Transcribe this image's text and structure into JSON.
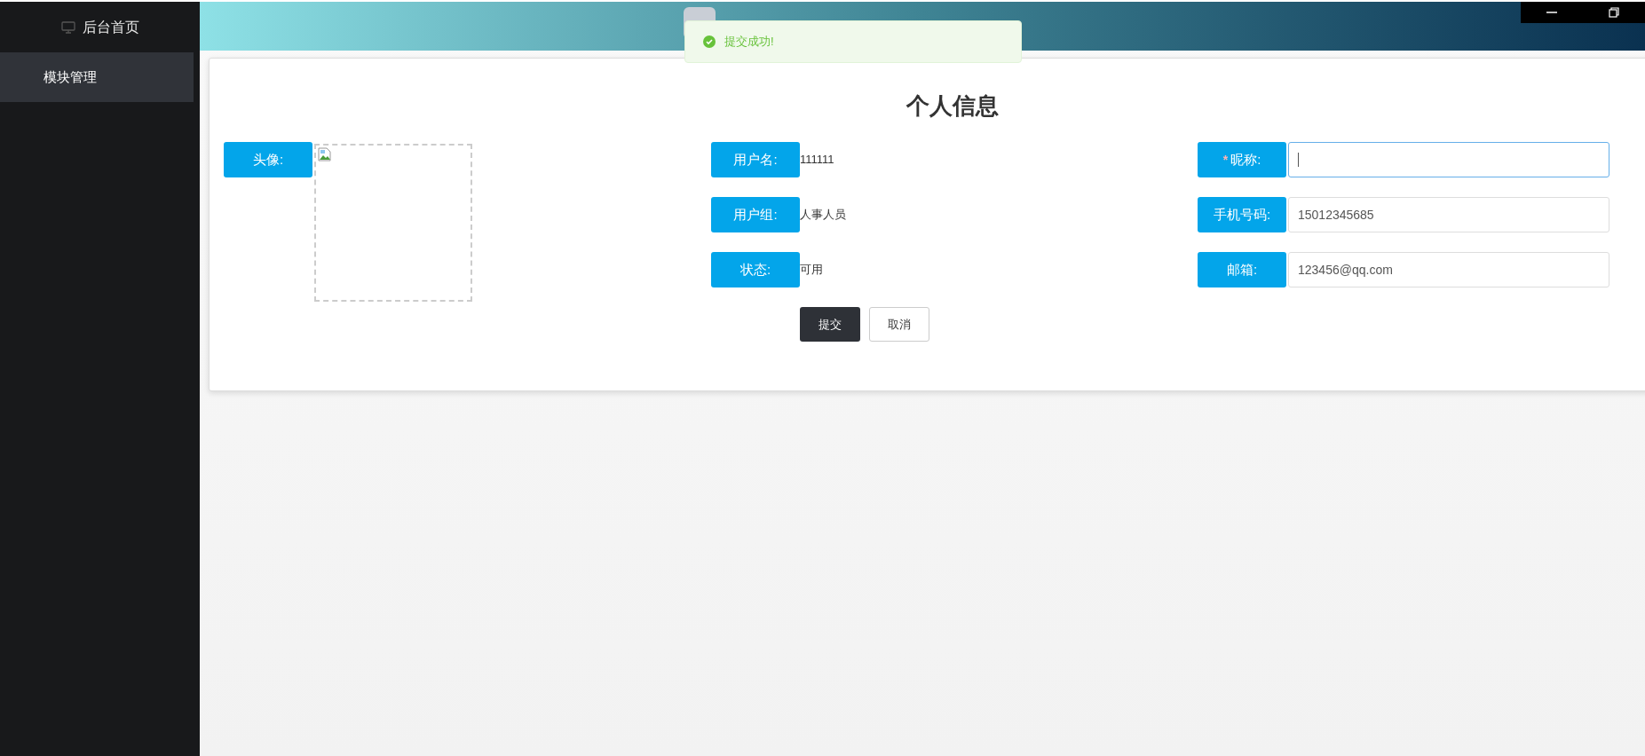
{
  "sidebar": {
    "header": "后台首页",
    "items": [
      {
        "label": "模块管理",
        "selected": true
      }
    ]
  },
  "toast": {
    "message": "提交成功!"
  },
  "form": {
    "title": "个人信息",
    "avatar": {
      "label": "头像:"
    },
    "info": [
      {
        "label": "用户名:",
        "value": "111111"
      },
      {
        "label": "用户组:",
        "value": "人事人员"
      },
      {
        "label": "状态:",
        "value": "可用"
      }
    ],
    "fields": [
      {
        "label": "昵称:",
        "required_mark": "*",
        "focused": true
      },
      {
        "label": "手机号码:",
        "value": "15012345685",
        "focused": false
      },
      {
        "label": "邮箱:",
        "value": "123456@qq.com",
        "focused": false
      }
    ],
    "buttons": [
      {
        "label": "提交",
        "kind": "primary"
      },
      {
        "label": "取消",
        "kind": "default"
      }
    ]
  }
}
